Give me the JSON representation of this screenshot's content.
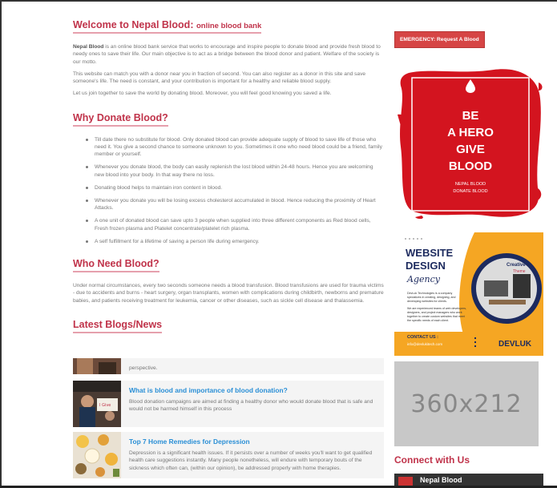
{
  "welcome": {
    "title": "Welcome to Nepal Blood:",
    "title_small": "online blood bank",
    "p1_bold": "Nepal Blood",
    "p1": " is an online blood bank service that works to encourage and inspire people to donate blood and provide fresh blood to needy ones to save their life. Our main objective is to act as a bridge between the blood donor and patient. Welfare of the society is our motto.",
    "p2": "This website can match you with a donor near you in fraction of second. You can also register as a donor in this site and save someone's life. The need is constant, and your contribution is important for a healthy and reliable blood supply.",
    "p3": "Let us join together to save the world by donating blood. Moreover, you will feel good knowing you saved a life."
  },
  "why": {
    "title": "Why Donate Blood?",
    "items": [
      "Till date there no substitute for blood. Only donated blood can provide adequate supply of blood to save life of those who need it. You give a second chance to someone unknown to you. Sometimes it one who need blood could be a friend, family member or yourself.",
      "Whenever you donate blood, the body can easily replenish the lost blood within 24-48 hours. Hence you are welcoming new blood into your body. In that way there no loss.",
      "Donating blood helps to maintain iron content in blood.",
      "Whenever you donate you will be losing excess cholesterol accumulated in blood. Hence reducing the proximity of Heart Attacks.",
      "A one unit of donated blood can save upto 3 people when supplied into three different components as Red blood cells, Fresh frozen plasma and Platelet concentrate/platelet rich plasma.",
      "A self fulfillment for a lifetime of saving a person life during emergency."
    ]
  },
  "who": {
    "title": "Who Need Blood?",
    "text": "Under normal circumstances, every two seconds someone needs a blood transfusion. Blood transfusions are used for trauma victims - due to accidents and burns - heart surgery, organ transplants, women with complications during childbirth, newborns and premature babies, and patients receiving treatment for leukemia, cancer or other diseases, such as sickle cell disease and thalassemia."
  },
  "blogs": {
    "title": "Latest Blogs/News",
    "partial_text": "perspective.",
    "items": [
      {
        "title": "What is blood and importance of blood donation?",
        "desc": "Blood donation campaigns are aimed at finding a healthy donor who would donate blood that is safe and would not be harmed himself in this process"
      },
      {
        "title": "Top 7 Home Remedies for Depression",
        "desc": "Depression is a significant health issues. If it persists over a number of weeks you'll want to get qualified health care suggestions instantly. Many people nonetheless, will endure with temporary bouts of the sickness which often can, (within our opinion), be addressed properly with home therapies."
      }
    ]
  },
  "sidebar": {
    "emergency_label": "EMERGENCY: Request A Blood",
    "hero_lines": [
      "BE",
      "A HERO",
      "GIVE",
      "BLOOD"
    ],
    "hero_sub1": "NEPAL BLOOD",
    "hero_sub2": "DONATE BLOOD",
    "ad": {
      "line1": "WEBSITE",
      "line2": "DESIGN",
      "line3": "Agency",
      "creative": "Creative",
      "theme": "Theme",
      "blurb1": "DevLuk Technologies is a company",
      "blurb2": "specializes in creating, designing, and",
      "blurb3": "developing websites for clients.",
      "blurb4": "We are experienced teams of web developers,",
      "blurb5": "designers, and project managers who work",
      "blurb6": "together to create custom websites that meet",
      "blurb7": "the specific needs of each client.",
      "contact": "CONTACT US :",
      "email": "info@devlukitech.com",
      "brand": "DEVLUK"
    },
    "placeholder": "360x212",
    "connect_title": "Connect with Us",
    "fb_name": "Nepal Blood"
  },
  "colors": {
    "accent": "#c0334a",
    "link": "#2a8fd6",
    "emergency": "#d64545",
    "hero_red": "#d3141f",
    "ad_orange": "#f5a623",
    "ad_navy": "#1c2a5e"
  }
}
